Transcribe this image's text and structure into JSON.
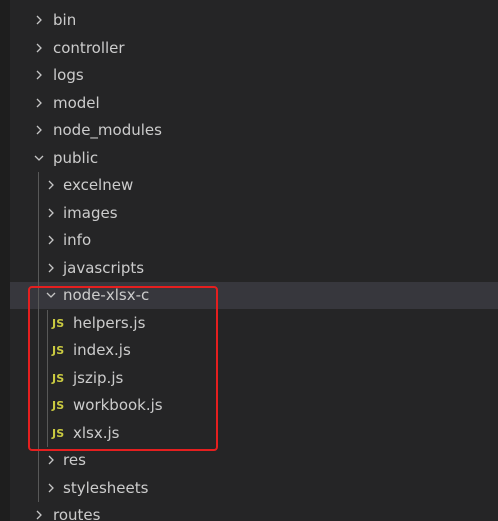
{
  "explorer": {
    "items": [
      {
        "label": "bin",
        "type": "folder",
        "state": "collapsed",
        "depth": 0
      },
      {
        "label": "controller",
        "type": "folder",
        "state": "collapsed",
        "depth": 0
      },
      {
        "label": "logs",
        "type": "folder",
        "state": "collapsed",
        "depth": 0
      },
      {
        "label": "model",
        "type": "folder",
        "state": "collapsed",
        "depth": 0
      },
      {
        "label": "node_modules",
        "type": "folder",
        "state": "collapsed",
        "depth": 0
      },
      {
        "label": "public",
        "type": "folder",
        "state": "expanded",
        "depth": 0
      },
      {
        "label": "excelnew",
        "type": "folder",
        "state": "collapsed",
        "depth": 1
      },
      {
        "label": "images",
        "type": "folder",
        "state": "collapsed",
        "depth": 1
      },
      {
        "label": "info",
        "type": "folder",
        "state": "collapsed",
        "depth": 1
      },
      {
        "label": "javascripts",
        "type": "folder",
        "state": "collapsed",
        "depth": 1
      },
      {
        "label": "node-xlsx-c",
        "type": "folder",
        "state": "expanded",
        "depth": 1,
        "selected": true
      },
      {
        "label": "helpers.js",
        "type": "file",
        "icon": "JS",
        "depth": 2
      },
      {
        "label": "index.js",
        "type": "file",
        "icon": "JS",
        "depth": 2
      },
      {
        "label": "jszip.js",
        "type": "file",
        "icon": "JS",
        "depth": 2
      },
      {
        "label": "workbook.js",
        "type": "file",
        "icon": "JS",
        "depth": 2
      },
      {
        "label": "xlsx.js",
        "type": "file",
        "icon": "JS",
        "depth": 2
      },
      {
        "label": "res",
        "type": "folder",
        "state": "collapsed",
        "depth": 1
      },
      {
        "label": "stylesheets",
        "type": "folder",
        "state": "collapsed",
        "depth": 1
      },
      {
        "label": "routes",
        "type": "folder",
        "state": "collapsed",
        "depth": 0
      }
    ]
  },
  "colors": {
    "background": "#252526",
    "selected_row": "#37373d",
    "js_icon": "#cbcb41",
    "annotation_box": "#e51f1f"
  }
}
